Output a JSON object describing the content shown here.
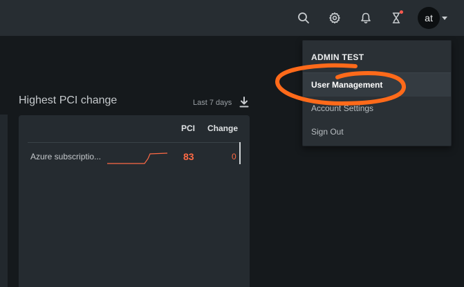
{
  "topbar": {
    "icons": [
      "search-icon",
      "gear-icon",
      "bell-icon",
      "hourglass-icon"
    ],
    "avatar_initials": "at"
  },
  "widget": {
    "title": "Highest PCI change",
    "range": "Last 7 days",
    "columns": [
      "PCI",
      "Change"
    ],
    "rows": [
      {
        "name": "Azure subscriptio...",
        "pci": "83",
        "change": "0"
      }
    ]
  },
  "user_menu": {
    "header": "ADMIN TEST",
    "items": [
      "User Management",
      "Account Settings",
      "Sign Out"
    ],
    "active_item": "User Management"
  },
  "colors": {
    "accent_orange": "#ff6a1a",
    "value_red": "#ff6a45",
    "notify_dot": "#ff5a4f"
  }
}
